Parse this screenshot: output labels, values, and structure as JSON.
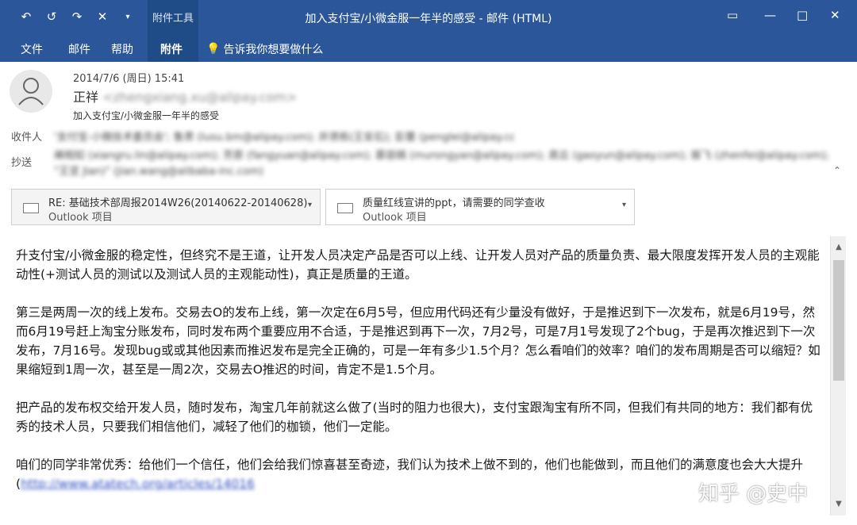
{
  "titlebar": {
    "title": "加入支付宝/小微金服一年半的感受  -  邮件 (HTML)",
    "context_tab": "附件工具",
    "qat_icons": [
      "reply-icon",
      "reply-all-icon",
      "forward-icon",
      "delete-icon",
      "qat-dropdown-icon"
    ],
    "window_controls": [
      "restore-icon",
      "minimize-icon",
      "maximize-icon",
      "close-icon"
    ]
  },
  "ribbon": {
    "tabs": [
      {
        "label": "文件"
      },
      {
        "label": "邮件"
      },
      {
        "label": "帮助"
      },
      {
        "label": "附件"
      }
    ],
    "tell_me": "告诉我你想要做什么"
  },
  "message": {
    "date": "2014/7/6 (周日) 15:41",
    "from_name": "正祥",
    "from_email": "<zhengxiang.xu@alipay.com>",
    "subject": "加入支付宝/小微金服一年半的感受",
    "to_label": "收件人",
    "to": "'支付宝-小微技术委员会'; 鲁肃 (lusu.bm@alipay.com); 井贤栋(王安石); 彭蕾 (penglei@alipay.com)",
    "cc_label": "抄送",
    "cc_line1": "阐相如 (xiangru.lin@alipay.com); 芳原 (fangyuan@alipay.com); 慕容嫣 (murongyan@alipay.com); 高云 (gaoyun@alipay.com); 振飞 (zhenfei@alipay.com);",
    "cc_line2": "\"王坚 Jian)\" (jian.wang@alibaba-inc.com)"
  },
  "attachments": [
    {
      "name": "RE: 基础技术部周报2014W26(20140622-20140628)",
      "type": "Outlook 项目"
    },
    {
      "name": "质量红线宣讲的ppt，请需要的同学查收",
      "type": "Outlook 项目"
    }
  ],
  "body": {
    "p1": "升支付宝/小微金服的稳定性，但终究不是王道，让开发人员决定产品是否可以上线、让开发人员对产品的质量负责、最大限度发挥开发人员的主观能动性(+测试人员的测试以及测试人员的主观能动性)，真正是质量的王道。",
    "p2": "第三是两周一次的线上发布。交易去O的发布上线，第一次定在6月5号，但应用代码还有少量没有做好，于是推迟到下一次发布，就是6月19号，然而6月19号赶上淘宝分账发布，同时发布两个重要应用不合适，于是推迟到再下一次，7月2号，可是7月1号发现了2个bug，于是再次推迟到下一次发布，7月16号。发现bug或或其他因素而推迟发布是完全正确的，可是一年有多少1.5个月？怎么看咱们的效率？咱们的发布周期是否可以缩短？如果缩短到1周一次，甚至是一周2次，交易去O推迟的时间，肯定不是1.5个月。",
    "p3": "把产品的发布权交给开发人员，随时发布，淘宝几年前就这么做了(当时的阻力也很大)，支付宝跟淘宝有所不同，但我们有共同的地方：我们都有优秀的技术人员，只要我们相信他们，减轻了他们的枷锁，他们一定能。",
    "p4": "咱们的同学非常优秀：给他们一个信任，他们会给我们惊喜甚至奇迹，我们认为技术上做不到的，他们也能做到，而且他们的满意度也会大大提升(",
    "p4_link": "http://www.atatech.org/articles/14016"
  },
  "watermark": "知乎 @史中"
}
